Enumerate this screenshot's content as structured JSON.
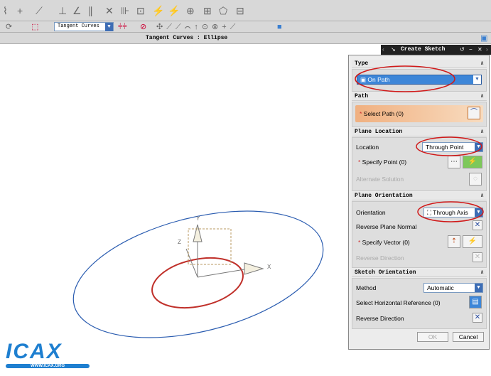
{
  "toolbar": {
    "filter_value": "Tangent Curves",
    "status": "Tangent Curves : Ellipse"
  },
  "dialog": {
    "title": "Create Sketch",
    "type": {
      "header": "Type",
      "value": "On Path"
    },
    "path": {
      "header": "Path",
      "select": "Select Path (0)"
    },
    "plane_location": {
      "header": "Plane Location",
      "location_label": "Location",
      "location_value": "Through Point",
      "specify_point": "Specify Point (0)",
      "alternate": "Alternate Solution"
    },
    "plane_orientation": {
      "header": "Plane Orientation",
      "orientation_label": "Orientation",
      "orientation_value": "Through Axis",
      "reverse_normal": "Reverse Plane Normal",
      "specify_vector": "Specify Vector (0)",
      "reverse_direction": "Reverse Direction"
    },
    "sketch_orientation": {
      "header": "Sketch Orientation",
      "method_label": "Method",
      "method_value": "Automatic",
      "horizontal_ref": "Select Horizontal Reference (0)",
      "reverse_direction": "Reverse Direction"
    },
    "ok": "OK",
    "cancel": "Cancel"
  },
  "canvas": {
    "axis_x": "X",
    "axis_y": "Y",
    "axis_z": "Z"
  },
  "logo": {
    "text": "ICAX",
    "url": "WWW.ICAX.ORG"
  },
  "colors": {
    "blue_curve": "#2a5cb0",
    "red_curve": "#c0302a",
    "highlight": "#3d86d8"
  }
}
